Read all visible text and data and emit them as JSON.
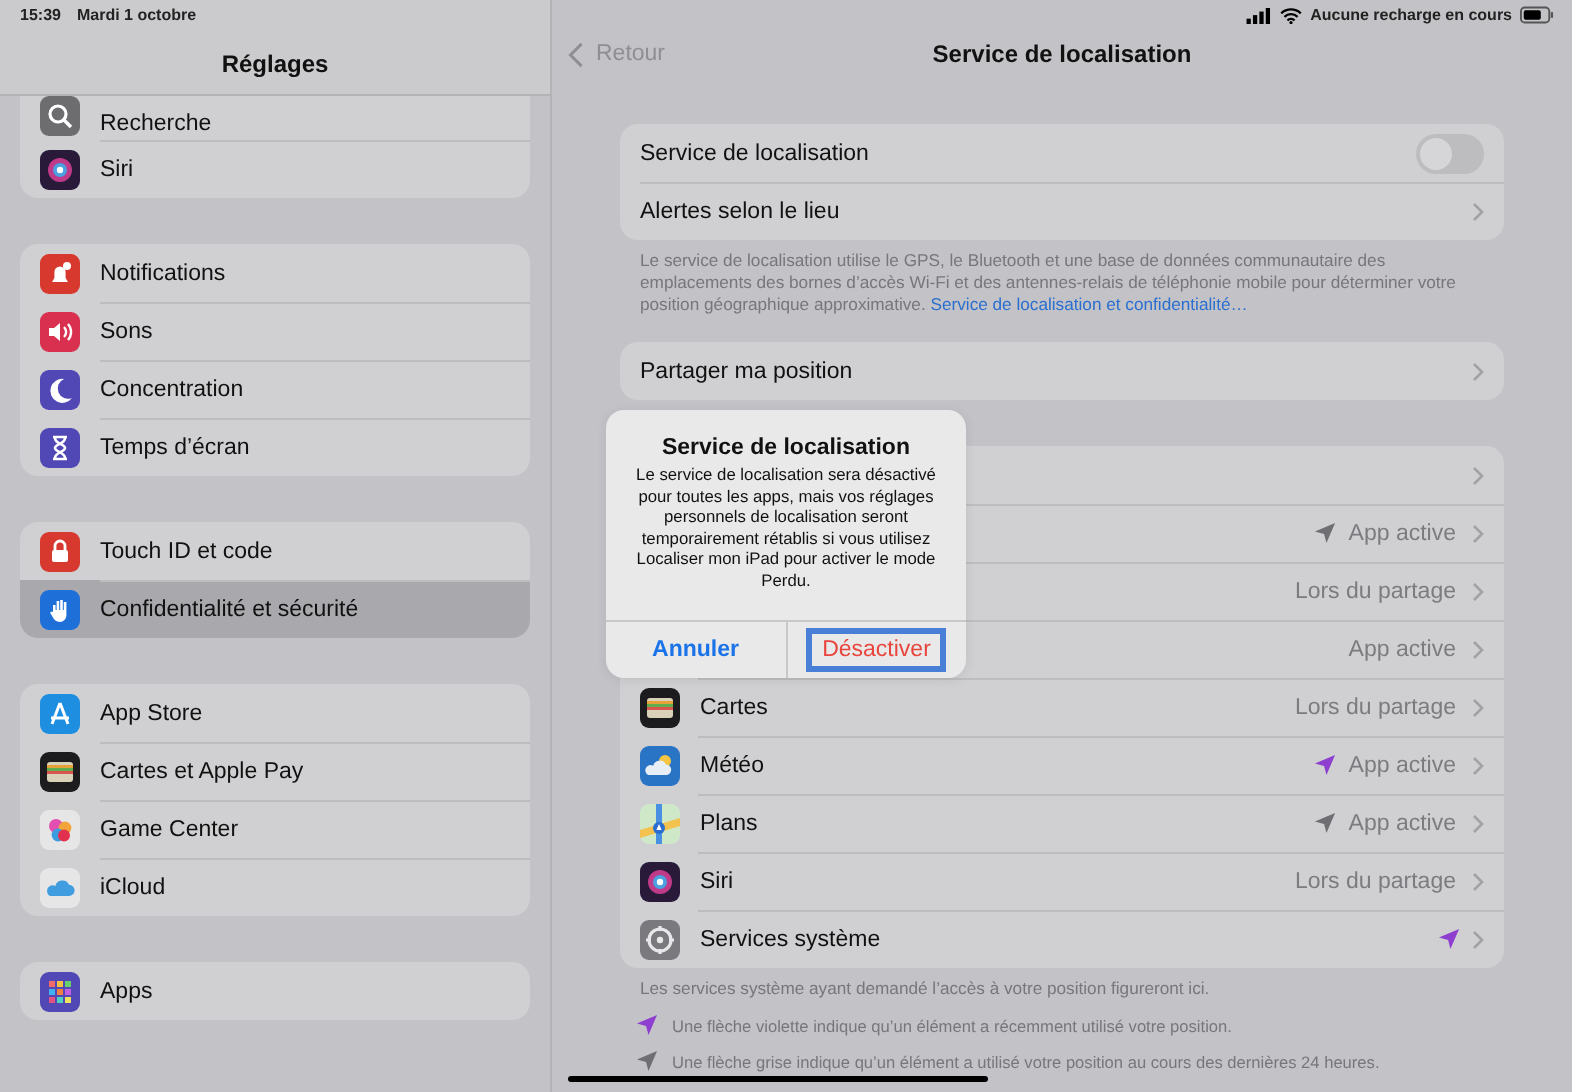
{
  "status_bar": {
    "time": "15:39",
    "date": "Mardi 1 octobre",
    "battery_text": "Aucune recharge en cours"
  },
  "sidebar": {
    "title": "Réglages",
    "groups": [
      [
        {
          "label": "Recherche",
          "selected": false
        },
        {
          "label": "Siri",
          "selected": false
        }
      ],
      [
        {
          "label": "Notifications",
          "selected": false
        },
        {
          "label": "Sons",
          "selected": false
        },
        {
          "label": "Concentration",
          "selected": false
        },
        {
          "label": "Temps d’écran",
          "selected": false
        }
      ],
      [
        {
          "label": "Touch ID et code",
          "selected": false
        },
        {
          "label": "Confidentialité et sécurité",
          "selected": true
        }
      ],
      [
        {
          "label": "App Store",
          "selected": false
        },
        {
          "label": "Cartes et Apple Pay",
          "selected": false
        },
        {
          "label": "Game Center",
          "selected": false
        },
        {
          "label": "iCloud",
          "selected": false
        }
      ],
      [
        {
          "label": "Apps",
          "selected": false
        }
      ]
    ]
  },
  "nav": {
    "back": "Retour",
    "title": "Service de localisation"
  },
  "main_group": [
    {
      "kind": "toggle",
      "label": "Service de localisation",
      "on": false
    },
    {
      "kind": "link",
      "label": "Alertes selon le lieu"
    }
  ],
  "main_footer": {
    "text": "Le service de localisation utilise le GPS, le Bluetooth et une base de données communautaire des emplacements des bornes d’accès Wi-Fi et des antennes-relais de téléphonie mobile pour déterminer votre position géographique approximative.",
    "link": "Service de localisation et confidentialité…"
  },
  "share_row": {
    "label": "Partager ma position"
  },
  "apps": [
    {
      "chevron": true
    },
    {
      "status": "App active",
      "color": "#6e6e73",
      "chevron": true
    },
    {
      "status": "Lors du partage",
      "chevron": true
    },
    {
      "status": "App active",
      "chevron": true
    },
    {
      "name": "Cartes",
      "status": "Lors du partage",
      "chevron": true
    },
    {
      "name": "Météo",
      "status": "App active",
      "color": "#8e3fd0",
      "chevron": true
    },
    {
      "name": "Plans",
      "status": "App active",
      "color": "#6e6e73",
      "chevron": true
    },
    {
      "name": "Siri",
      "status": "Lors du partage",
      "chevron": true
    },
    {
      "name": "Services système",
      "color": "#8e3fd0",
      "chevron": true
    }
  ],
  "apps_footer": "Les services système ayant demandé l’accès à votre position figureront ici.",
  "legend": [
    {
      "text": "Une flèche violette indique qu’un élément a récemment utilisé votre position.",
      "color": "#8e3fd0"
    },
    {
      "text": "Une flèche grise indique qu’un élément a utilisé votre position au cours des dernières 24 heures.",
      "color": "#6e6e73"
    }
  ],
  "dialog": {
    "title": "Service de localisation",
    "message": "Le service de localisation sera désactivé pour toutes les apps, mais vos réglages personnels de localisation seront temporairement rétablis si vous utilisez Localiser mon iPad pour activer le mode Perdu.",
    "buttons": [
      {
        "label": "Annuler",
        "kind": "cancel",
        "focused": false
      },
      {
        "label": "Désactiver",
        "kind": "destructive",
        "focused": true
      }
    ]
  }
}
